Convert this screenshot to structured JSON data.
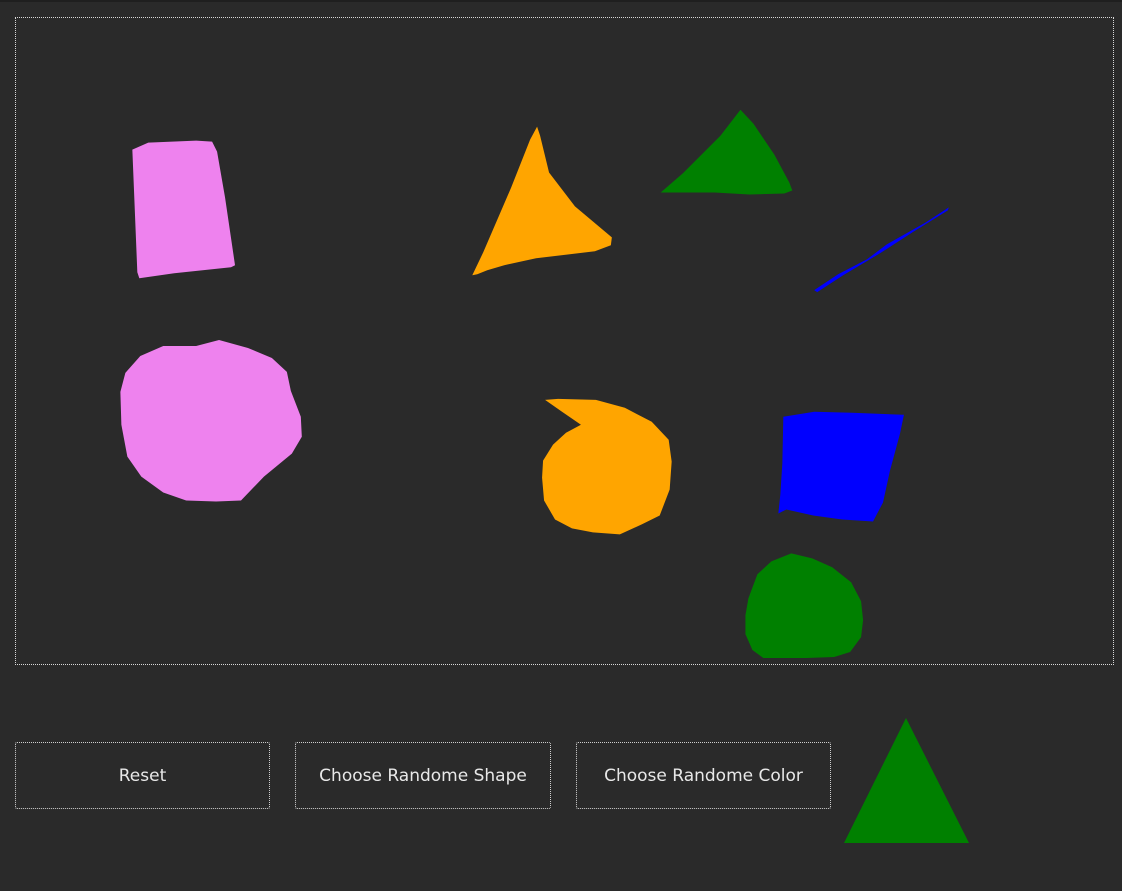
{
  "buttons": {
    "reset_label": "Reset",
    "random_shape_label": "Choose Randome Shape",
    "random_color_label": "Choose Randome Color"
  },
  "canvas": {
    "background": "#2a2a2a",
    "shapes": [
      {
        "kind": "quadrilateral",
        "color": "#ee82ee"
      },
      {
        "kind": "triangle",
        "color": "#ffa500"
      },
      {
        "kind": "triangle",
        "color": "#008000"
      },
      {
        "kind": "line",
        "color": "#0000ff"
      },
      {
        "kind": "circle",
        "color": "#ee82ee"
      },
      {
        "kind": "circle",
        "color": "#ffa500"
      },
      {
        "kind": "quadrilateral",
        "color": "#0000ff"
      },
      {
        "kind": "circle",
        "color": "#008000"
      }
    ]
  },
  "preview": {
    "shape": "triangle",
    "color": "#008000"
  }
}
